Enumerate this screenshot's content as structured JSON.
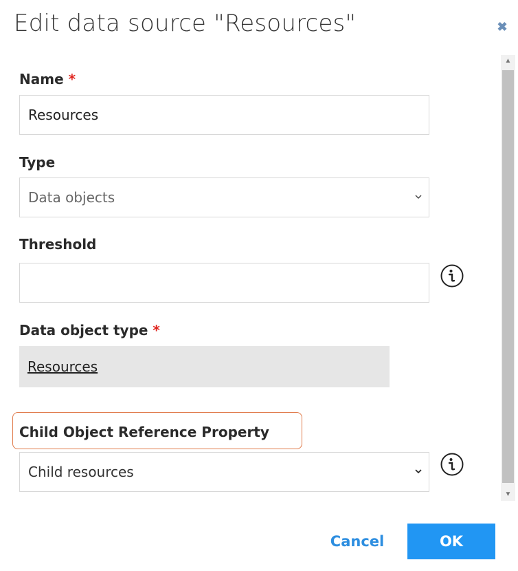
{
  "dialog": {
    "title": "Edit data source \"Resources\"",
    "close_icon": "close-icon"
  },
  "form": {
    "name": {
      "label": "Name",
      "required": "*",
      "value": "Resources"
    },
    "type": {
      "label": "Type",
      "value": "Data objects"
    },
    "threshold": {
      "label": "Threshold",
      "value": ""
    },
    "data_object_type": {
      "label": "Data object type",
      "required": "*",
      "value": "Resources"
    },
    "child_object_reference": {
      "label": "Child Object Reference Property",
      "value": "Child resources"
    }
  },
  "footer": {
    "cancel_label": "Cancel",
    "ok_label": "OK"
  },
  "colors": {
    "primary": "#2196f3",
    "link": "#2d8ee0",
    "required": "#e0261f",
    "highlight": "#e07a4a"
  }
}
